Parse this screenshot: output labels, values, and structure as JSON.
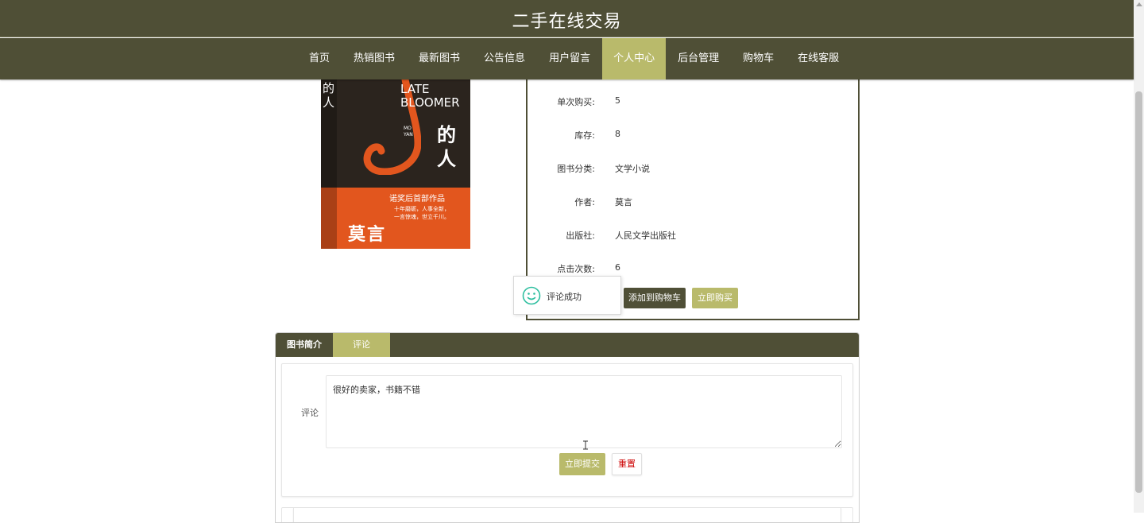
{
  "header": {
    "title": "二手在线交易"
  },
  "nav": {
    "items": [
      {
        "label": "首页",
        "active": false
      },
      {
        "label": "热销图书",
        "active": false
      },
      {
        "label": "最新图书",
        "active": false
      },
      {
        "label": "公告信息",
        "active": false
      },
      {
        "label": "用户留言",
        "active": false
      },
      {
        "label": "个人中心",
        "active": true
      },
      {
        "label": "后台管理",
        "active": false
      },
      {
        "label": "购物车",
        "active": false
      },
      {
        "label": "在线客服",
        "active": false
      }
    ]
  },
  "book": {
    "cover": {
      "title_en": "LATE\nBLOOMER",
      "title_cn_part1": "的",
      "title_cn_part2": "人",
      "side_text": "的人",
      "author_en": "MO\nYAN",
      "series": "诺奖后首部作品",
      "blurb": "十年磨砺，人事全新，\n一言惊魂，世立千川。",
      "author_cn": "莫言"
    },
    "details": [
      {
        "label": "单次购买:",
        "value": "5"
      },
      {
        "label": "库存:",
        "value": "8"
      },
      {
        "label": "图书分类:",
        "value": "文学小说"
      },
      {
        "label": "作者:",
        "value": "莫言"
      },
      {
        "label": "出版社:",
        "value": "人民文学出版社"
      },
      {
        "label": "点击次数:",
        "value": "6"
      }
    ],
    "add_to_cart_label": "添加到购物车",
    "buy_now_label": "立即购买"
  },
  "toast": {
    "icon": "smile-icon",
    "message": "评论成功"
  },
  "tabs": [
    {
      "label": "图书简介",
      "active": false
    },
    {
      "label": "评论",
      "active": true
    }
  ],
  "comment_form": {
    "label": "评论",
    "value": "很好的卖家，书籍不错",
    "submit_label": "立即提交",
    "reset_label": "重置"
  },
  "colors": {
    "primary": "#4f4f36",
    "accent": "#b9ba6b",
    "danger": "#cc0000"
  }
}
